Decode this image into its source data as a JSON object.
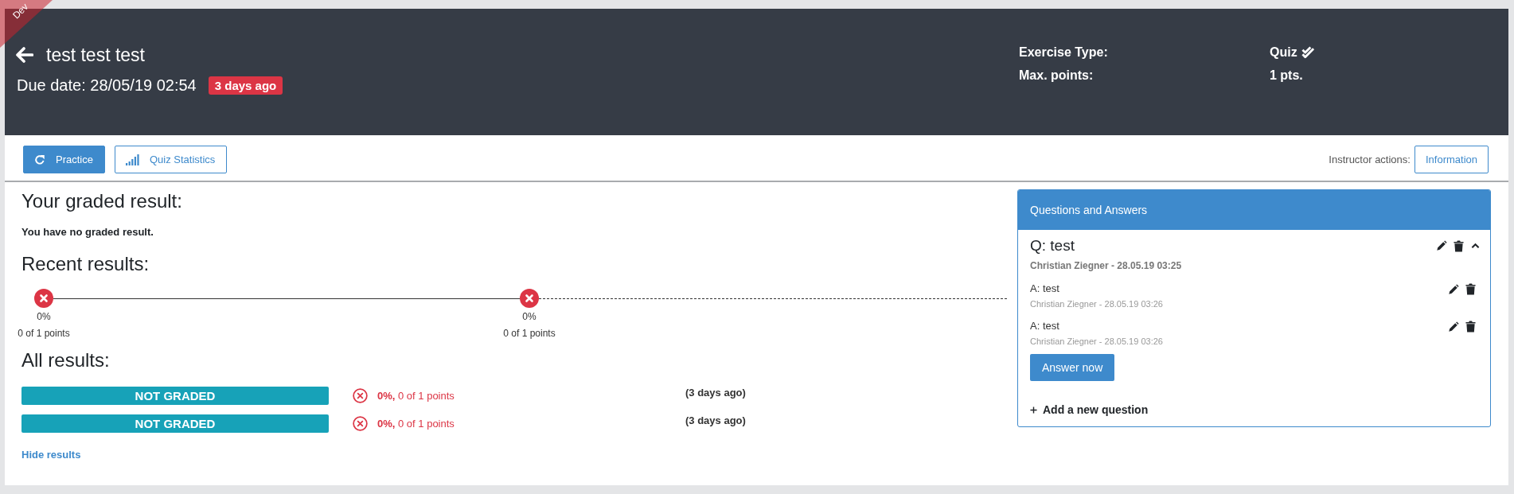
{
  "ribbon": {
    "label": "Dev"
  },
  "header": {
    "title": "test test test",
    "due_date": "Due date: 28/05/19 02:54",
    "due_badge": "3 days ago",
    "info": [
      {
        "label": "Exercise Type:",
        "value": "Quiz",
        "kind": "type"
      },
      {
        "label": "Max. points:",
        "value": "1 pts.",
        "kind": "plain"
      }
    ]
  },
  "toolbar": {
    "buttons": [
      {
        "label": "Practice",
        "kind": "primary"
      },
      {
        "label": "Quiz Statistics",
        "kind": "outline"
      }
    ],
    "instructor_label": "Instructor actions:",
    "instructor_button": "Information"
  },
  "graded": {
    "heading": "Your graded result:",
    "text": "You have no graded result."
  },
  "recent": {
    "heading": "Recent results:",
    "points": [
      {
        "percent": "0%",
        "points": "0 of 1 points",
        "successful": false
      },
      {
        "percent": "0%",
        "points": "0 of 1 points",
        "successful": false
      }
    ]
  },
  "all_results": {
    "heading": "All results:",
    "rows": [
      {
        "status": "NOT GRADED",
        "successful": false,
        "score": "**0%,** 0 of 1 points",
        "time": "(3 days ago)"
      },
      {
        "status": "NOT GRADED",
        "successful": false,
        "score": "**0%,** 0 of 1 points",
        "time": "(3 days ago)"
      }
    ],
    "toggle": "Hide results"
  },
  "qa": {
    "title": "Questions and Answers",
    "questions": [
      {
        "text": "Q: test",
        "meta": "Christian Ziegner - 28.05.19 03:25",
        "expanded": true,
        "answers": [
          {
            "text": "A: test",
            "meta": "Christian Ziegner - 28.05.19 03:26"
          },
          {
            "text": "A: test",
            "meta": "Christian Ziegner - 28.05.19 03:26"
          }
        ]
      }
    ],
    "answer_button": "Answer now",
    "add_label": "Add a new question"
  }
}
